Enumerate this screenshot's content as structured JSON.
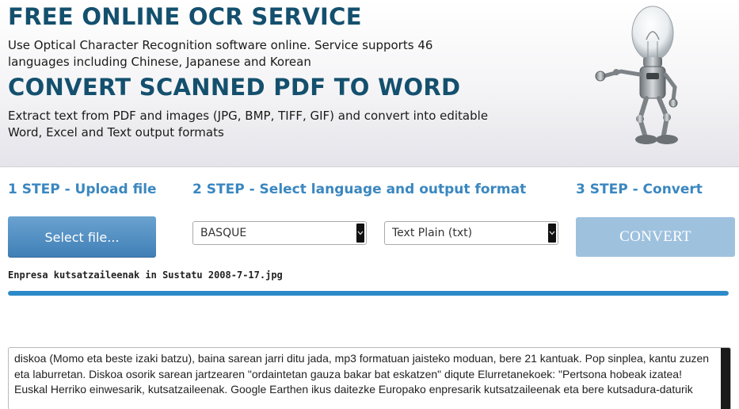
{
  "header": {
    "title_ocr": "FREE ONLINE OCR SERVICE",
    "desc_ocr": "Use Optical Character Recognition software online. Service supports 46 languages including Chinese, Japanese and Korean",
    "title_convert": "CONVERT SCANNED PDF TO WORD",
    "desc_convert": "Extract text from PDF and images (JPG, BMP, TIFF, GIF) and convert into editable Word, Excel and Text output formats",
    "mascot_icon": "lightbulb-robot-icon"
  },
  "steps": {
    "step1": "1 STEP - Upload file",
    "step2": "2 STEP - Select language and output format",
    "step3": "3 STEP - Convert"
  },
  "controls": {
    "select_file_label": "Select file...",
    "language_value": "BASQUE",
    "format_value": "Text Plain (txt)",
    "convert_label": "CONVERT"
  },
  "upload": {
    "filename": "Enpresa kutsatzaileenak in Sustatu 2008-7-17.jpg",
    "progress": 1.0
  },
  "output": {
    "text": "diskoa (Momo eta beste izaki batzu), baina sarean jarri ditu jada, mp3 formatuan jaisteko moduan, bere 21 kantuak. Pop sinplea, kantu zuzen eta laburretan. Diskoa osorik sarean jartzearen \"ordaintetan gauza bakar bat eskatzen\" diqute Elurretanekoek: \"Pertsona hobeak izatea!\nEuskal Herriko einwesarik, kutsatzaileenak. Google Earthen ikus daitezke Europako enpresarik kutsatzaileenak eta bere kutsadura-daturik"
  },
  "colors": {
    "title": "#14506e",
    "step": "#3a87c0",
    "select_button": "#4f8cc2",
    "convert_button": "#9ec1de",
    "progress": "#2c8ac9"
  }
}
